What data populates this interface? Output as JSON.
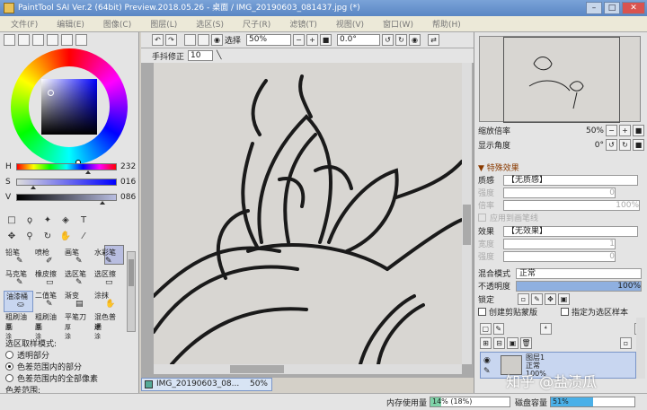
{
  "window": {
    "title": "PaintTool SAI Ver.2 (64bit) Preview.2018.05.26 - 桌面 / IMG_20190603_081437.jpg (*)",
    "min": "–",
    "max": "□",
    "close": "✕"
  },
  "menu": [
    "文件(F)",
    "编辑(E)",
    "图像(C)",
    "图层(L)",
    "选区(S)",
    "尺子(R)",
    "滤镜(T)",
    "视图(V)",
    "窗口(W)",
    "帮助(H)"
  ],
  "color": {
    "h_label": "H",
    "h_value": "232",
    "s_label": "S",
    "s_value": "016",
    "v_label": "V",
    "v_value": "086",
    "hue": 232,
    "sat": 0.16,
    "val": 0.86,
    "accent": "#b8bde0"
  },
  "brushes": [
    {
      "name": "铅笔",
      "icon": "✎"
    },
    {
      "name": "喷枪",
      "icon": "✐"
    },
    {
      "name": "画笔",
      "icon": "✎"
    },
    {
      "name": "水彩笔",
      "icon": "✎"
    },
    {
      "name": "马克笔",
      "icon": "✎"
    },
    {
      "name": "橡皮擦",
      "icon": "▭"
    },
    {
      "name": "选区笔",
      "icon": "✎"
    },
    {
      "name": "选区擦",
      "icon": "▭"
    },
    {
      "name": "油漆桶",
      "icon": "⛀"
    },
    {
      "name": "二值笔",
      "icon": "✎"
    },
    {
      "name": "渐变",
      "icon": "▤"
    },
    {
      "name": "涂抹",
      "icon": "✋"
    },
    {
      "name": "粗刷油画",
      "icon": "✎"
    },
    {
      "name": "粗刷油画",
      "icon": "✎"
    },
    {
      "name": "平笔刀",
      "icon": "✎"
    },
    {
      "name": "混色普通",
      "icon": "✎"
    }
  ],
  "brush_sublabel": "厚涂",
  "selection": {
    "heading": "选区取样模式:",
    "options": [
      "透明部分",
      "色差范围内的部分",
      "色差范围内的全部像素"
    ],
    "selected": 1,
    "range_label": "色差范围:"
  },
  "canvas_toolbar": {
    "select_label": "选择",
    "zoom": "50%",
    "angle": "0.0°",
    "stabilizer_label": "手抖修正",
    "stabilizer_value": "10"
  },
  "doc_tab": {
    "name": "IMG_20190603_08...",
    "zoom": "50%"
  },
  "status": {
    "memory_label": "内存使用量",
    "memory_value": "14% (18%)",
    "memory_fraction": 0.14,
    "disk_label": "磁盘容量",
    "disk_value": "51%",
    "disk_fraction": 0.51
  },
  "right": {
    "zoom_label": "缩放倍率",
    "zoom_value": "50%",
    "angle_label": "显示角度",
    "angle_value": "0°",
    "section_title": "▼ 特殊效果",
    "texture_label": "质感",
    "texture_value": "【无质感】",
    "strength_label": "强度",
    "strength_value": "0",
    "scale_label": "倍率",
    "scale_value": "100%",
    "apply_brush_label": "应用到画笔线",
    "effect_label": "效果",
    "effect_value": "【无效果】",
    "width_label": "宽度",
    "width_value": "1",
    "effect_strength_label": "强度",
    "effect_strength_value": "0",
    "blend_label": "混合模式",
    "blend_value": "正常",
    "opacity_label": "不透明度",
    "opacity_value": "100%",
    "lock_label": "锁定",
    "clip_label": "创建剪贴蒙版",
    "ref_label": "指定为选区样本",
    "layer_name": "图层1",
    "layer_mode": "正常",
    "layer_opacity": "100%"
  },
  "watermark": "知乎 @盐渍瓜"
}
